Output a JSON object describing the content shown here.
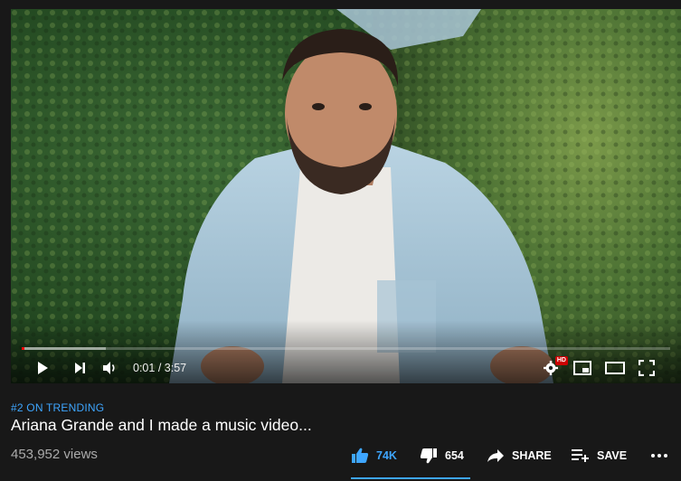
{
  "player": {
    "current_time": "0:01",
    "duration": "3:57",
    "time_separator": " / ",
    "progress_played": 0.0042,
    "progress_buffered": 0.13,
    "hd_badge": "HD",
    "icons": {
      "play": "play-icon",
      "next": "next-icon",
      "volume": "volume-icon",
      "settings": "gear-icon",
      "miniplayer": "miniplayer-icon",
      "theater": "theater-mode-icon",
      "fullscreen": "fullscreen-icon"
    }
  },
  "video": {
    "trending_tag": "#2 ON TRENDING",
    "title": "Ariana Grande and I made a music video...",
    "views": "453,952 views"
  },
  "actions": {
    "like_count": "74K",
    "dislike_count": "654",
    "share_label": "SHARE",
    "save_label": "SAVE",
    "more_icon": "more-horizontal-icon"
  },
  "colors": {
    "accent": "#3ea6ff",
    "progress": "#ff0000",
    "background": "#181818",
    "secondary_text": "#aaaaaa"
  }
}
